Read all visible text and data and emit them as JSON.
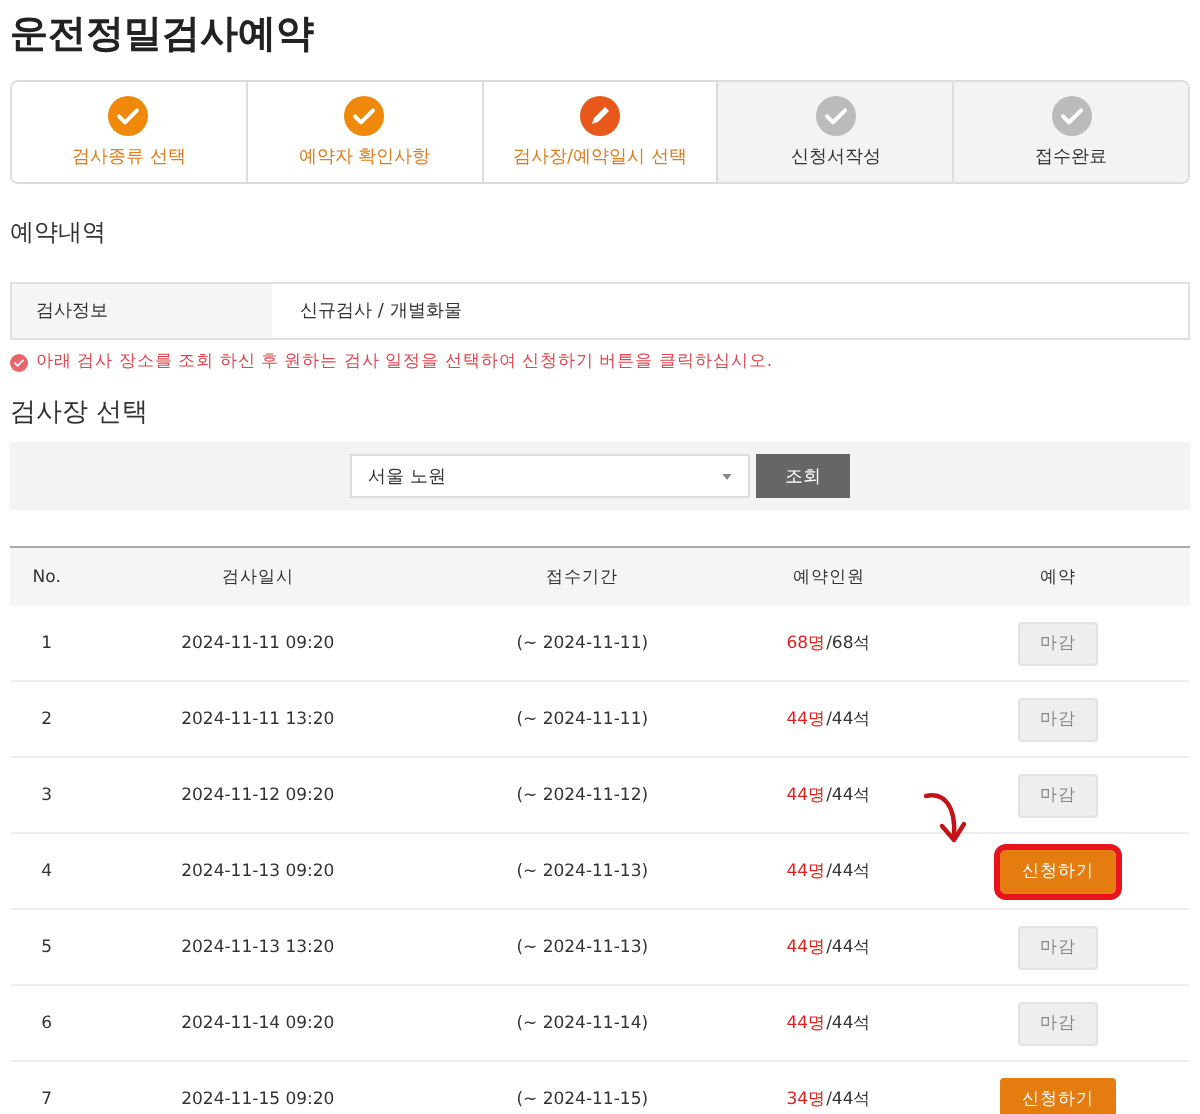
{
  "page_title": "운전정밀검사예약",
  "steps": [
    {
      "label": "검사종류 선택",
      "kind": "done"
    },
    {
      "label": "예약자 확인사항",
      "kind": "done"
    },
    {
      "label": "검사장/예약일시 선택",
      "kind": "current"
    },
    {
      "label": "신청서작성",
      "kind": "pending"
    },
    {
      "label": "접수완료",
      "kind": "pending"
    }
  ],
  "reservation_heading": "예약내역",
  "info": {
    "label": "검사정보",
    "value": "신규검사 / 개별화물"
  },
  "notice": "아래 검사 장소를 조회 하신 후 원하는 검사 일정을 선택하여 신청하기 버튼을 클릭하십시오.",
  "center_heading": "검사장 선택",
  "search": {
    "value": "서울 노원",
    "button": "조회"
  },
  "table": {
    "columns": [
      "No.",
      "검사일시",
      "접수기간",
      "예약인원",
      "예약"
    ],
    "rows": [
      {
        "no": "1",
        "datetime": "2024-11-11 09:20",
        "period": "(~ 2024-11-11)",
        "reserved": "68명",
        "seats": "/68석",
        "action": "마감",
        "kind": "closed",
        "highlighted": false
      },
      {
        "no": "2",
        "datetime": "2024-11-11 13:20",
        "period": "(~ 2024-11-11)",
        "reserved": "44명",
        "seats": "/44석",
        "action": "마감",
        "kind": "closed",
        "highlighted": false
      },
      {
        "no": "3",
        "datetime": "2024-11-12 09:20",
        "period": "(~ 2024-11-12)",
        "reserved": "44명",
        "seats": "/44석",
        "action": "마감",
        "kind": "closed",
        "highlighted": false
      },
      {
        "no": "4",
        "datetime": "2024-11-13 09:20",
        "period": "(~ 2024-11-13)",
        "reserved": "44명",
        "seats": "/44석",
        "action": "신청하기",
        "kind": "apply",
        "highlighted": true
      },
      {
        "no": "5",
        "datetime": "2024-11-13 13:20",
        "period": "(~ 2024-11-13)",
        "reserved": "44명",
        "seats": "/44석",
        "action": "마감",
        "kind": "closed",
        "highlighted": false
      },
      {
        "no": "6",
        "datetime": "2024-11-14 09:20",
        "period": "(~ 2024-11-14)",
        "reserved": "44명",
        "seats": "/44석",
        "action": "마감",
        "kind": "closed",
        "highlighted": false
      },
      {
        "no": "7",
        "datetime": "2024-11-15 09:20",
        "period": "(~ 2024-11-15)",
        "reserved": "34명",
        "seats": "/44석",
        "action": "신청하기",
        "kind": "apply",
        "highlighted": false
      }
    ]
  }
}
